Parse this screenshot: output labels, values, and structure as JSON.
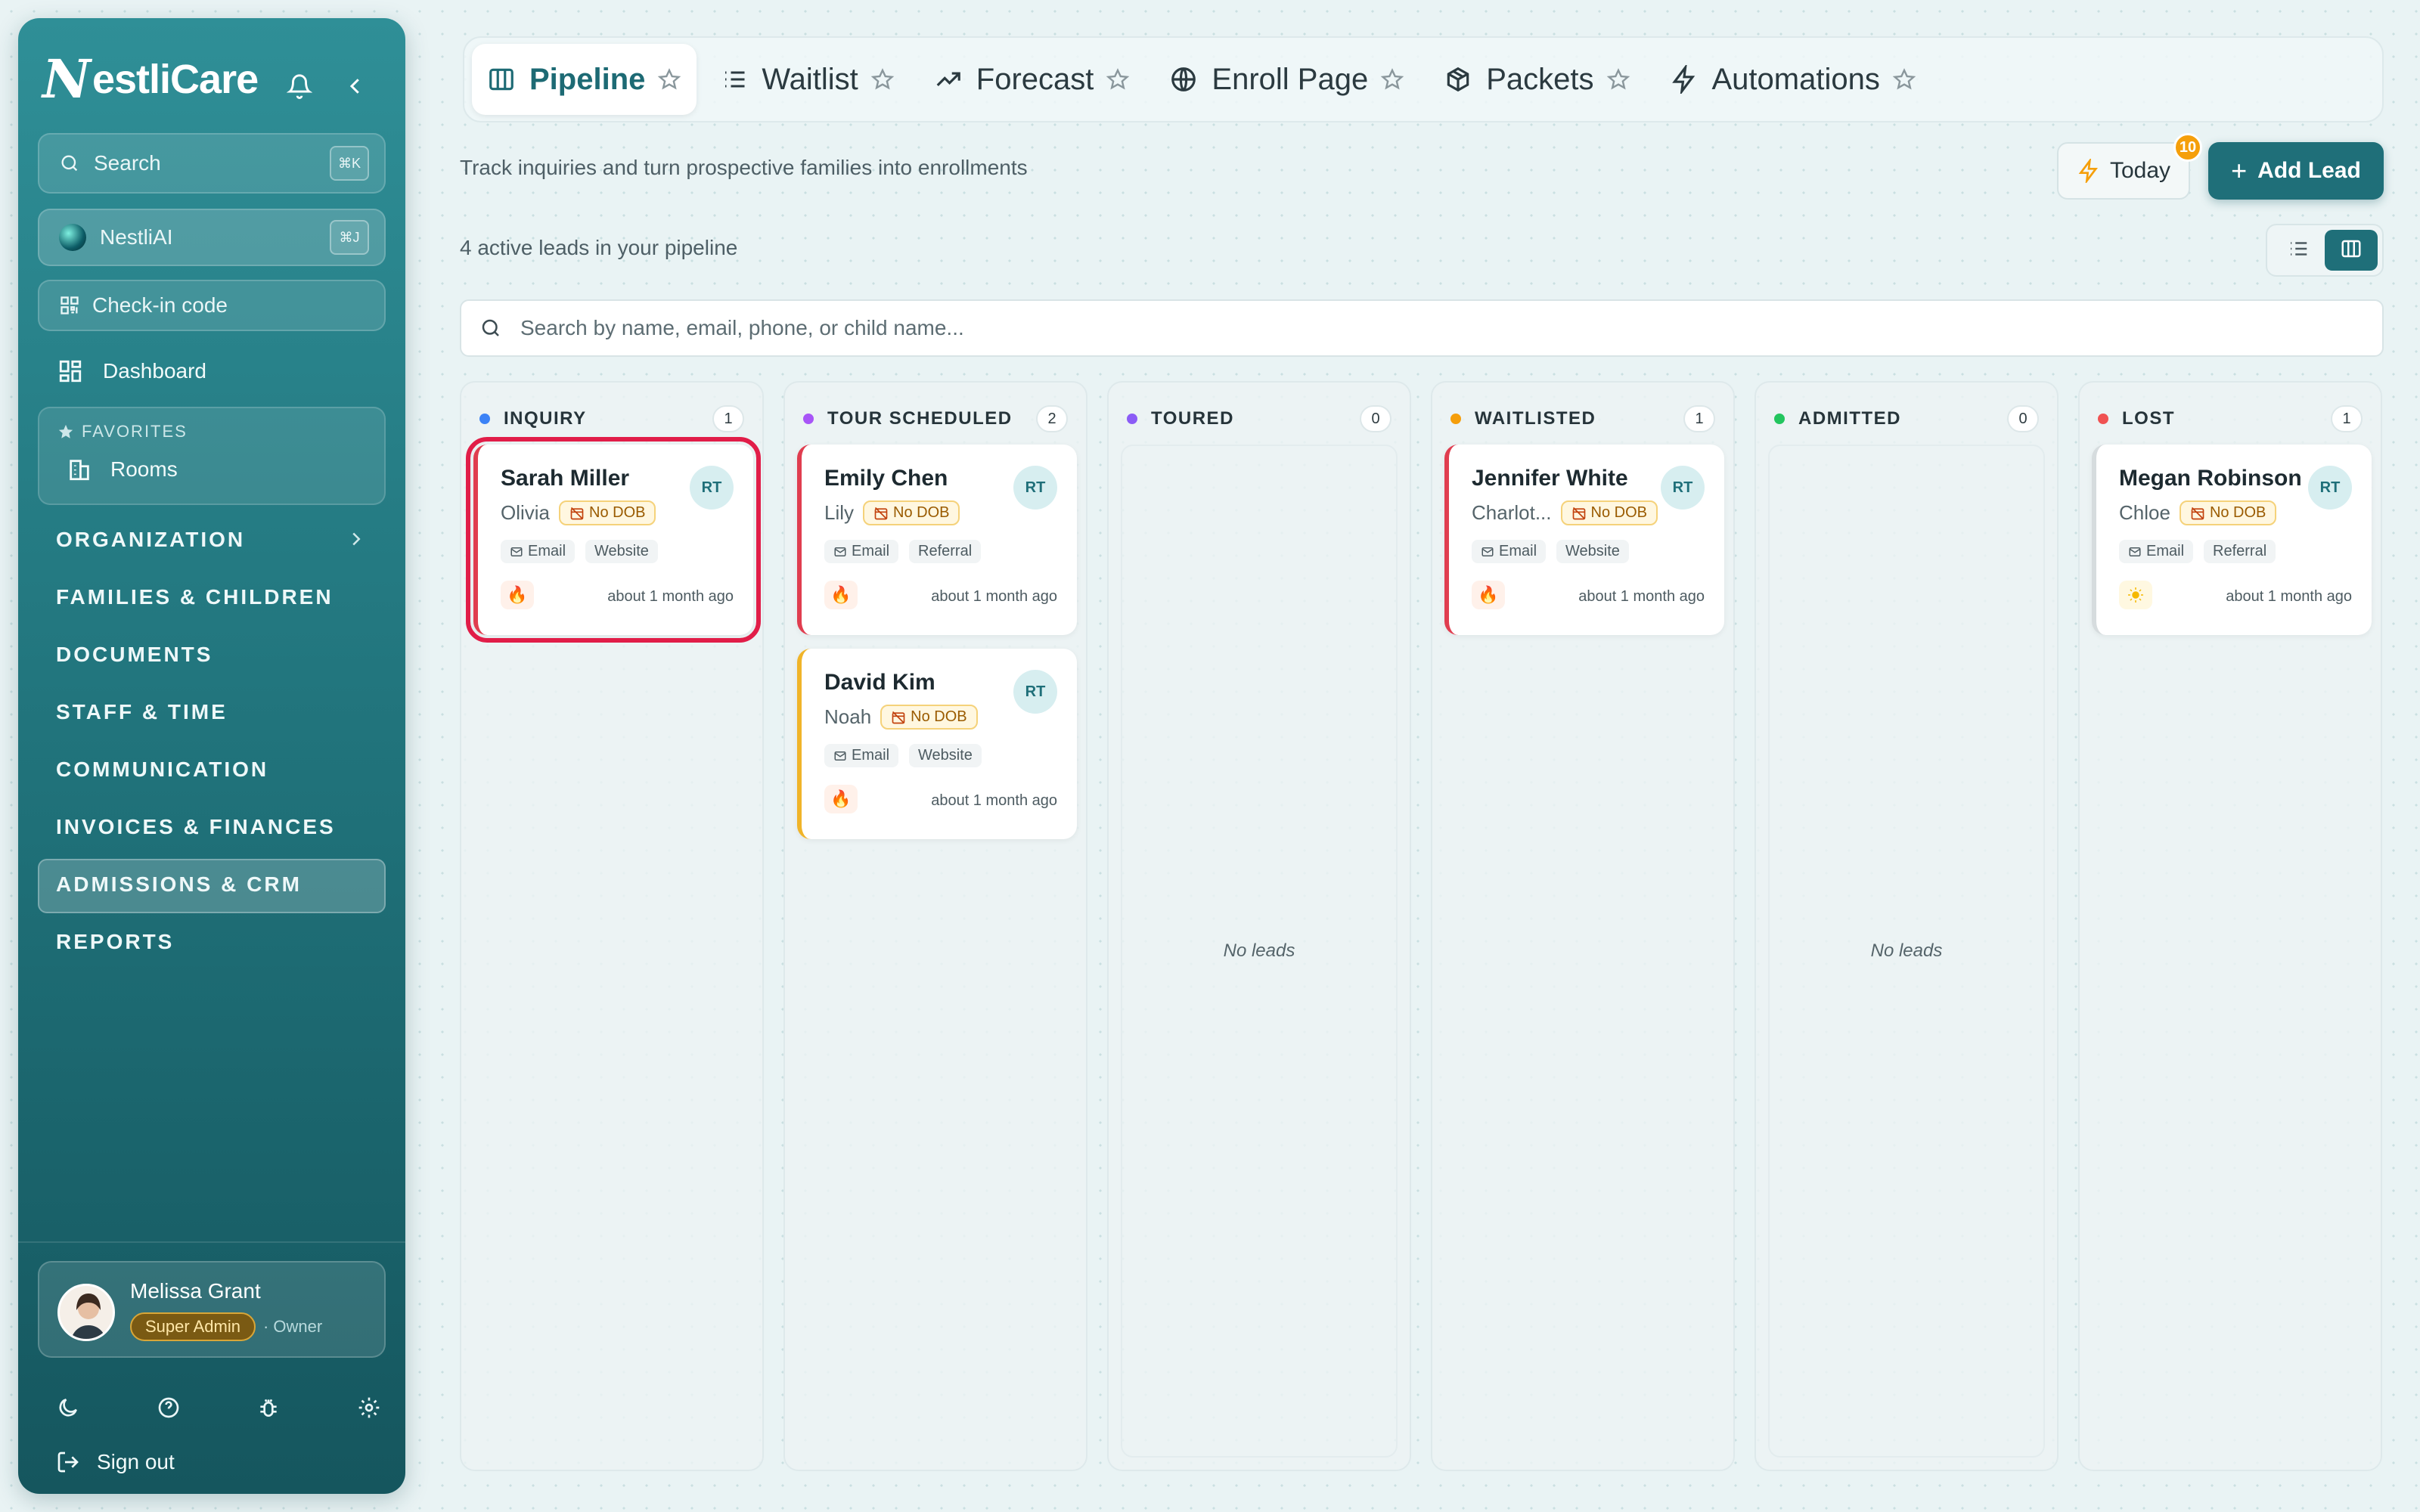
{
  "sidebar": {
    "brand": "estliCare",
    "brand_initial": "N",
    "search": {
      "label": "Search",
      "shortcut": "⌘K"
    },
    "ai": {
      "label": "NestliAI",
      "shortcut": "⌘J"
    },
    "checkin": {
      "label": "Check-in code"
    },
    "dashboard": "Dashboard",
    "favorites": {
      "heading": "FAVORITES",
      "items": [
        "Rooms"
      ]
    },
    "sections": [
      "ORGANIZATION",
      "FAMILIES & CHILDREN",
      "DOCUMENTS",
      "STAFF & TIME",
      "COMMUNICATION",
      "INVOICES & FINANCES",
      "ADMISSIONS & CRM",
      "REPORTS"
    ],
    "active_section": "ADMISSIONS & CRM",
    "user": {
      "name": "Melissa Grant",
      "role": "Super Admin",
      "title": "· Owner"
    },
    "signout": "Sign out"
  },
  "tabs": [
    {
      "label": "Pipeline",
      "icon": "kanban-icon",
      "active": true
    },
    {
      "label": "Waitlist",
      "icon": "list-icon",
      "active": false
    },
    {
      "label": "Forecast",
      "icon": "trend-icon",
      "active": false
    },
    {
      "label": "Enroll Page",
      "icon": "globe-icon",
      "active": false
    },
    {
      "label": "Packets",
      "icon": "package-icon",
      "active": false
    },
    {
      "label": "Automations",
      "icon": "bolt-icon",
      "active": false
    }
  ],
  "header": {
    "subtitle": "Track inquiries and turn prospective families into enrollments",
    "today_label": "Today",
    "today_badge": "10",
    "add_lead": "Add Lead",
    "count_text": "4 active leads in your pipeline",
    "search_placeholder": "Search by name, email, phone, or child name..."
  },
  "columns": [
    {
      "title": "INQUIRY",
      "count": "1",
      "color": "#3b82f6"
    },
    {
      "title": "TOUR SCHEDULED",
      "count": "2",
      "color": "#a855f7"
    },
    {
      "title": "TOURED",
      "count": "0",
      "color": "#8b5cf6",
      "empty": "No leads"
    },
    {
      "title": "WAITLISTED",
      "count": "1",
      "color": "#f59e0b"
    },
    {
      "title": "ADMITTED",
      "count": "0",
      "color": "#22c55e",
      "empty": "No leads"
    },
    {
      "title": "LOST",
      "count": "1",
      "color": "#f05252"
    }
  ],
  "cards": {
    "sarah": {
      "name": "Sarah Miller",
      "child": "Olivia",
      "dob": "No DOB",
      "tags": [
        "Email",
        "Website"
      ],
      "initials": "RT",
      "time": "about 1 month ago",
      "priority": "hot"
    },
    "emily": {
      "name": "Emily Chen",
      "child": "Lily",
      "dob": "No DOB",
      "tags": [
        "Email",
        "Referral"
      ],
      "initials": "RT",
      "time": "about 1 month ago",
      "priority": "hot"
    },
    "david": {
      "name": "David Kim",
      "child": "Noah",
      "dob": "No DOB",
      "tags": [
        "Email",
        "Website"
      ],
      "initials": "RT",
      "time": "about 1 month ago",
      "priority": "hot"
    },
    "jennifer": {
      "name": "Jennifer White",
      "child": "Charlot...",
      "dob": "No DOB",
      "tags": [
        "Email",
        "Website"
      ],
      "initials": "RT",
      "time": "about 1 month ago",
      "priority": "hot"
    },
    "megan": {
      "name": "Megan Robinson",
      "child": "Chloe",
      "dob": "No DOB",
      "tags": [
        "Email",
        "Referral"
      ],
      "initials": "RT",
      "time": "about 1 month ago",
      "priority": "warm"
    }
  },
  "colors": {
    "accent": "#1f6f79",
    "selected": "#e11d48",
    "badge": "#f59f0a"
  }
}
